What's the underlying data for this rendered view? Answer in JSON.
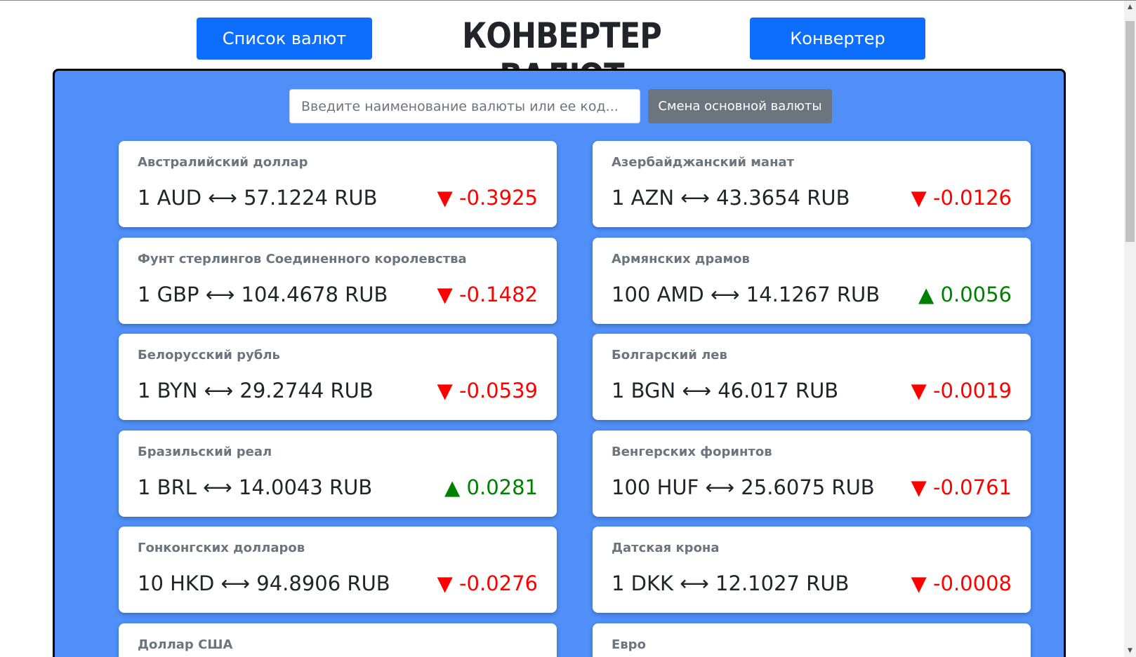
{
  "header": {
    "list_button": "Список валют",
    "title": "КОНВЕРТЕР ВАЛЮТ",
    "converter_button": "Конвертер"
  },
  "search": {
    "placeholder": "Введите наименование валюты или ее код...",
    "change_base_button": "Смена основной валюты"
  },
  "colors": {
    "down": "#ff0000",
    "up": "#008000"
  },
  "currencies": [
    {
      "name": "Австралийский доллар",
      "rate": "1 AUD ⟷ 57.1224 RUB",
      "direction": "down",
      "change": "▼ -0.3925"
    },
    {
      "name": "Азербайджанский манат",
      "rate": "1 AZN ⟷ 43.3654 RUB",
      "direction": "down",
      "change": "▼ -0.0126"
    },
    {
      "name": "Фунт стерлингов Соединенного королевства",
      "rate": "1 GBP ⟷ 104.4678 RUB",
      "direction": "down",
      "change": "▼ -0.1482"
    },
    {
      "name": "Армянских драмов",
      "rate": "100 AMD ⟷ 14.1267 RUB",
      "direction": "up",
      "change": "▲ 0.0056"
    },
    {
      "name": "Белорусский рубль",
      "rate": "1 BYN ⟷ 29.2744 RUB",
      "direction": "down",
      "change": "▼ -0.0539"
    },
    {
      "name": "Болгарский лев",
      "rate": "1 BGN ⟷ 46.017 RUB",
      "direction": "down",
      "change": "▼ -0.0019"
    },
    {
      "name": "Бразильский реал",
      "rate": "1 BRL ⟷ 14.0043 RUB",
      "direction": "up",
      "change": "▲ 0.0281"
    },
    {
      "name": "Венгерских форинтов",
      "rate": "100 HUF ⟷ 25.6075 RUB",
      "direction": "down",
      "change": "▼ -0.0761"
    },
    {
      "name": "Гонконгских долларов",
      "rate": "10 HKD ⟷ 94.8906 RUB",
      "direction": "down",
      "change": "▼ -0.0276"
    },
    {
      "name": "Датская крона",
      "rate": "1 DKK ⟷ 12.1027 RUB",
      "direction": "down",
      "change": "▼ -0.0008"
    },
    {
      "name": "Доллар США",
      "rate": "",
      "direction": "",
      "change": ""
    },
    {
      "name": "Евро",
      "rate": "",
      "direction": "",
      "change": ""
    }
  ]
}
